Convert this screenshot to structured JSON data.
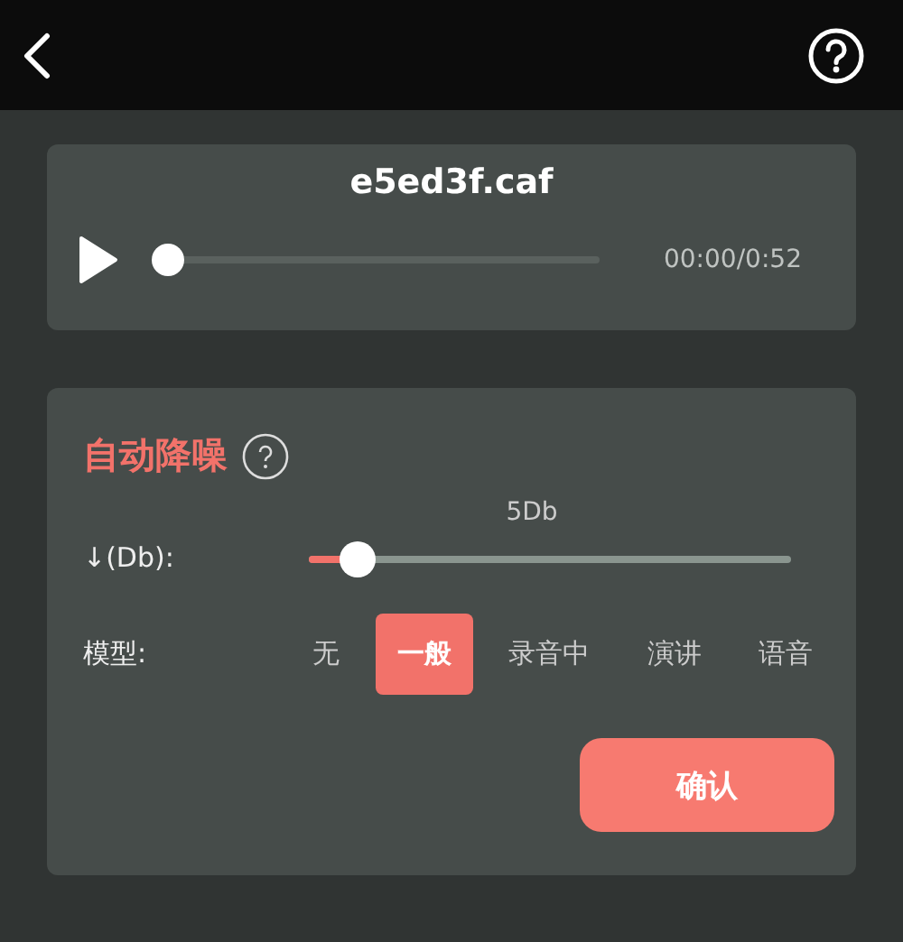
{
  "player": {
    "filename": "e5ed3f.caf",
    "level": 0.0,
    "time": "00:00/0:52"
  },
  "noise": {
    "title": "自动降噪",
    "slider_label": "↓(Db):",
    "slider_value": "5Db",
    "level": 0.1,
    "model_label": "模型:",
    "models": [
      {
        "label": "无",
        "selected": false
      },
      {
        "label": "一般",
        "selected": true
      },
      {
        "label": "录音中",
        "selected": false
      },
      {
        "label": "演讲",
        "selected": false
      },
      {
        "label": "语音",
        "selected": false
      }
    ],
    "confirm": "确认"
  }
}
